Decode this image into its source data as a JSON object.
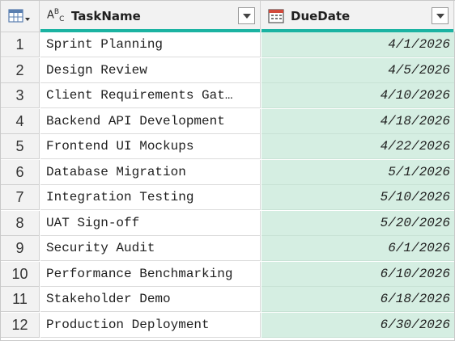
{
  "columns": {
    "task": {
      "header": "TaskName",
      "type_icon": "text-type-icon"
    },
    "due": {
      "header": "DueDate",
      "type_icon": "date-type-icon"
    }
  },
  "colors": {
    "accent": "#1bb3a2",
    "selected_column_bg": "#d5eee2",
    "header_bg": "#f2f2f2"
  },
  "rows": [
    {
      "n": "1",
      "task": "Sprint Planning",
      "due": "4/1/2026"
    },
    {
      "n": "2",
      "task": "Design Review",
      "due": "4/5/2026"
    },
    {
      "n": "3",
      "task": "Client Requirements Gat…",
      "due": "4/10/2026"
    },
    {
      "n": "4",
      "task": "Backend API Development",
      "due": "4/18/2026"
    },
    {
      "n": "5",
      "task": "Frontend UI Mockups",
      "due": "4/22/2026"
    },
    {
      "n": "6",
      "task": "Database Migration",
      "due": "5/1/2026"
    },
    {
      "n": "7",
      "task": "Integration Testing",
      "due": "5/10/2026"
    },
    {
      "n": "8",
      "task": "UAT Sign-off",
      "due": "5/20/2026"
    },
    {
      "n": "9",
      "task": "Security Audit",
      "due": "6/1/2026"
    },
    {
      "n": "10",
      "task": "Performance Benchmarking",
      "due": "6/10/2026"
    },
    {
      "n": "11",
      "task": "Stakeholder Demo",
      "due": "6/18/2026"
    },
    {
      "n": "12",
      "task": "Production Deployment",
      "due": "6/30/2026"
    }
  ]
}
